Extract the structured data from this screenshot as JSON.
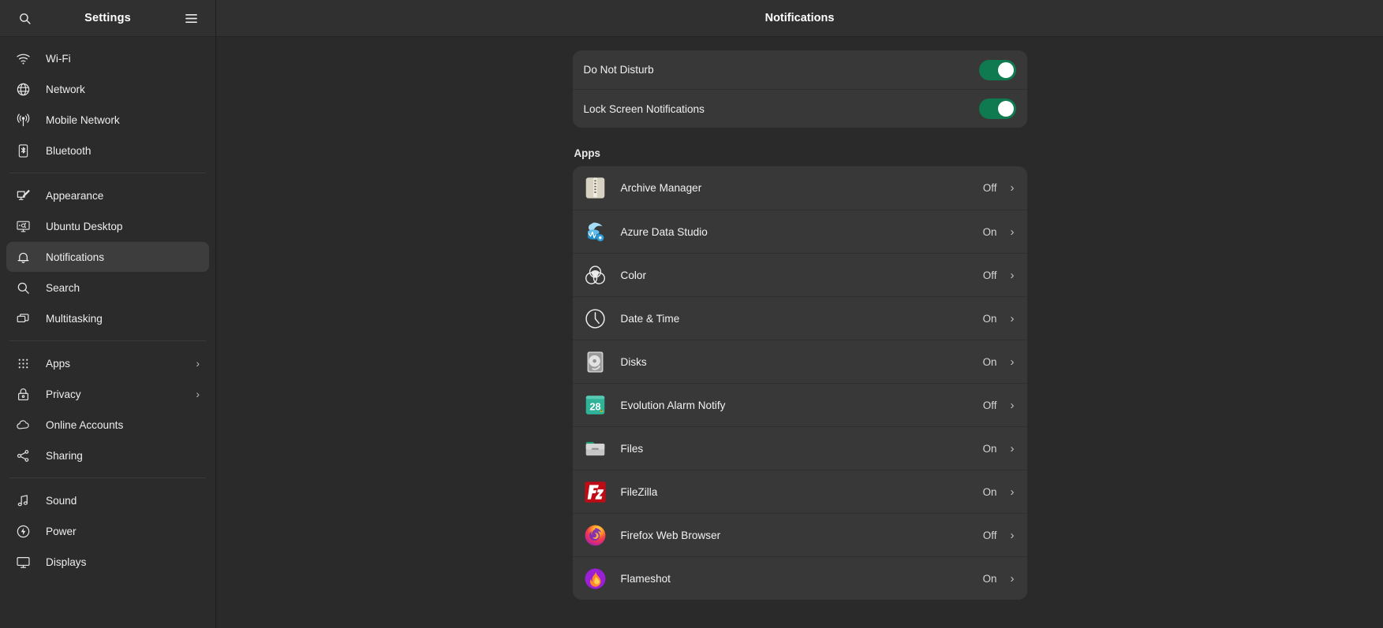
{
  "window": {
    "sidebar_title": "Settings",
    "main_title": "Notifications"
  },
  "sidebar": {
    "search_icon": "search-icon",
    "menu_icon": "hamburger-menu-icon",
    "groups": [
      {
        "items": [
          {
            "label": "Wi-Fi",
            "icon": "wifi-icon",
            "selected": false,
            "chevron": ""
          },
          {
            "label": "Network",
            "icon": "network-icon",
            "selected": false,
            "chevron": ""
          },
          {
            "label": "Mobile Network",
            "icon": "mobile-network-icon",
            "selected": false,
            "chevron": ""
          },
          {
            "label": "Bluetooth",
            "icon": "bluetooth-icon",
            "selected": false,
            "chevron": ""
          }
        ]
      },
      {
        "items": [
          {
            "label": "Appearance",
            "icon": "appearance-icon",
            "selected": false,
            "chevron": ""
          },
          {
            "label": "Ubuntu Desktop",
            "icon": "ubuntu-desktop-icon",
            "selected": false,
            "chevron": ""
          },
          {
            "label": "Notifications",
            "icon": "bell-icon",
            "selected": true,
            "chevron": ""
          },
          {
            "label": "Search",
            "icon": "search-icon",
            "selected": false,
            "chevron": ""
          },
          {
            "label": "Multitasking",
            "icon": "multitasking-icon",
            "selected": false,
            "chevron": ""
          }
        ]
      },
      {
        "items": [
          {
            "label": "Apps",
            "icon": "apps-grid-icon",
            "selected": false,
            "chevron": "›"
          },
          {
            "label": "Privacy",
            "icon": "lock-icon",
            "selected": false,
            "chevron": "›"
          },
          {
            "label": "Online Accounts",
            "icon": "cloud-icon",
            "selected": false,
            "chevron": ""
          },
          {
            "label": "Sharing",
            "icon": "share-icon",
            "selected": false,
            "chevron": ""
          }
        ]
      },
      {
        "items": [
          {
            "label": "Sound",
            "icon": "sound-note-icon",
            "selected": false,
            "chevron": ""
          },
          {
            "label": "Power",
            "icon": "power-icon",
            "selected": false,
            "chevron": ""
          },
          {
            "label": "Displays",
            "icon": "display-icon",
            "selected": false,
            "chevron": ""
          }
        ]
      }
    ]
  },
  "main": {
    "switches": [
      {
        "label": "Do Not Disturb",
        "state": "on"
      },
      {
        "label": "Lock Screen Notifications",
        "state": "on"
      }
    ],
    "apps_section_title": "Apps",
    "apps": [
      {
        "name": "Archive Manager",
        "state": "Off",
        "icon": "archive-manager-icon"
      },
      {
        "name": "Azure Data Studio",
        "state": "On",
        "icon": "azure-data-studio-icon"
      },
      {
        "name": "Color",
        "state": "Off",
        "icon": "color-icon"
      },
      {
        "name": "Date & Time",
        "state": "On",
        "icon": "date-time-clock-icon"
      },
      {
        "name": "Disks",
        "state": "On",
        "icon": "disks-icon"
      },
      {
        "name": "Evolution Alarm Notify",
        "state": "Off",
        "icon": "evolution-alarm-notify-icon",
        "badge": "28"
      },
      {
        "name": "Files",
        "state": "On",
        "icon": "files-folder-icon"
      },
      {
        "name": "FileZilla",
        "state": "On",
        "icon": "filezilla-icon",
        "glyph": "FZ"
      },
      {
        "name": "Firefox Web Browser",
        "state": "Off",
        "icon": "firefox-icon"
      },
      {
        "name": "Flameshot",
        "state": "On",
        "icon": "flameshot-icon"
      }
    ],
    "row_chevron": "›"
  },
  "colors": {
    "toggle_on": "#0f7a4f",
    "card_bg": "#383838",
    "page_bg": "#2a2a2a",
    "sidebar_bg": "#2b2b2b",
    "selected_bg": "#3d3d3d"
  }
}
